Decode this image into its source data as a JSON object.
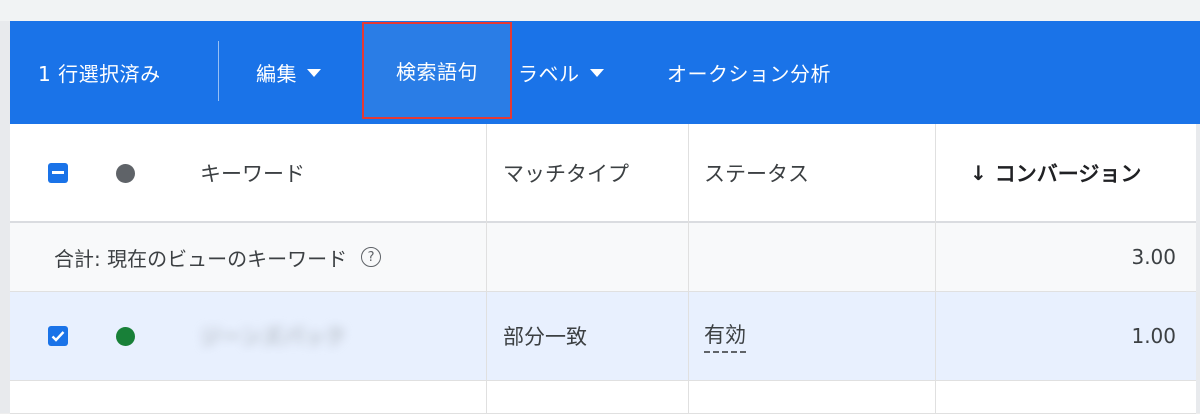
{
  "toolbar": {
    "selected_label": "1 行選択済み",
    "edit_label": "編集",
    "search_terms_label": "検索語句",
    "label_label": "ラベル",
    "auction_label": "オークション分析",
    "accent_color": "#1a73e8",
    "highlight_border_color": "#e53935"
  },
  "table": {
    "columns": {
      "keyword": "キーワード",
      "match_type": "マッチタイプ",
      "status": "ステータス",
      "conversions": "コンバージョン",
      "sort_indicator": "↓"
    },
    "total_row": {
      "label": "合計: 現在のビューのキーワード",
      "help": "?",
      "conversions": "3.00"
    },
    "rows": [
      {
        "keyword": "ジーンズパック",
        "match_type": "部分一致",
        "status": "有効",
        "conversions": "1.00",
        "checked": true,
        "status_dot_color": "#188038"
      }
    ],
    "header_dot_color": "#5f6368"
  }
}
